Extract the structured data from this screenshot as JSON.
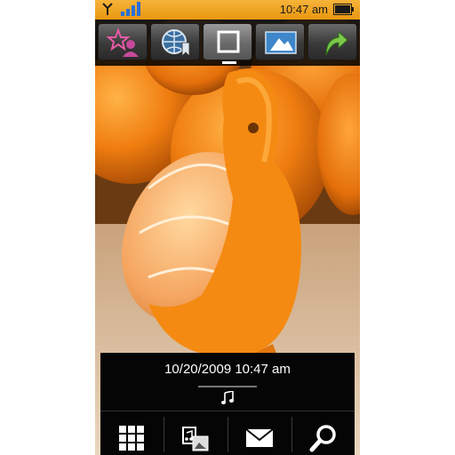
{
  "status_bar": {
    "time": "10:47 am",
    "signal_bars": 4,
    "antenna_icon": "antenna-icon",
    "battery_icon": "battery-icon"
  },
  "toolbar": {
    "items": [
      {
        "icon": "favorite-contact-icon"
      },
      {
        "icon": "web-bookmark-icon"
      },
      {
        "icon": "fullscreen-icon",
        "active": true
      },
      {
        "icon": "wallpaper-icon"
      },
      {
        "icon": "share-arrow-icon"
      }
    ]
  },
  "photo": {
    "subject": "orange-peel-bird-photo"
  },
  "info_panel": {
    "datetime": "10/20/2009 10:47 am",
    "music_icon": "music-note-icon"
  },
  "bottom_bar": {
    "items": [
      {
        "icon": "grid-menu-icon"
      },
      {
        "icon": "media-gallery-icon"
      },
      {
        "icon": "mail-icon"
      },
      {
        "icon": "search-icon"
      }
    ]
  },
  "colors": {
    "status_bar": "#f0a623",
    "toolbar_bg": "#111111",
    "panel_bg": "#050505"
  }
}
